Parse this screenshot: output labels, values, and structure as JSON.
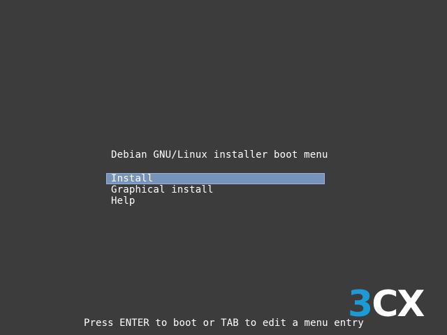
{
  "boot_menu": {
    "title": "Debian GNU/Linux installer boot menu",
    "items": [
      {
        "label": "Install",
        "selected": true
      },
      {
        "label": "Graphical install",
        "selected": false
      },
      {
        "label": "Help",
        "selected": false
      }
    ],
    "hint": "Press ENTER to boot or TAB to edit a menu entry"
  },
  "logo": {
    "text": "3CX",
    "part_a": "3",
    "part_b": "CX",
    "color_primary": "#1d9ad6",
    "color_secondary": "#ffffff"
  },
  "colors": {
    "background": "#3c3c3c",
    "selection": "#7593bb",
    "text": "#ffffff"
  }
}
